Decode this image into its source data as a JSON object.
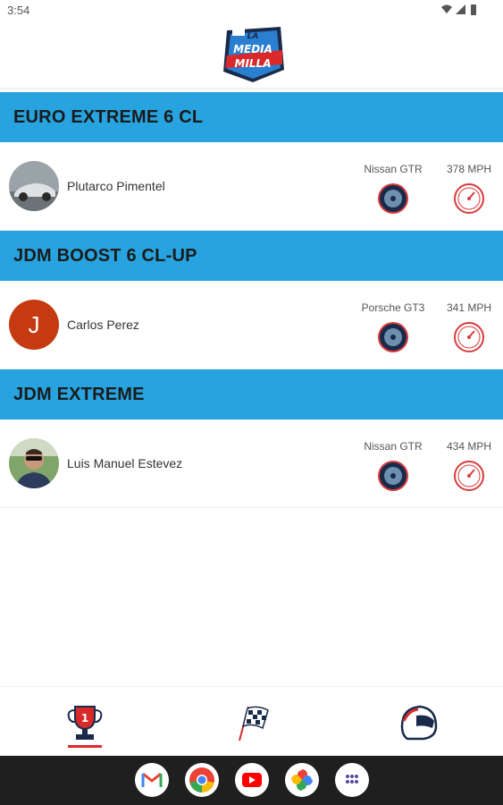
{
  "status_bar": {
    "time": "3:54"
  },
  "logo": {
    "text_top": "LA",
    "text_main": "MEDIA",
    "text_sub": "MILLA"
  },
  "sections": [
    {
      "title": "EURO EXTREME 6 CL",
      "entries": [
        {
          "driver": "Plutarco Pimentel",
          "car": "Nissan GTR",
          "speed": "378 MPH",
          "avatar": "car-photo"
        }
      ]
    },
    {
      "title": "JDM BOOST 6 CL-UP",
      "entries": [
        {
          "driver": "Carlos Perez",
          "car": "Porsche GT3",
          "speed": "341 MPH",
          "avatar_letter": "J",
          "avatar_color": "#c53a11"
        }
      ]
    },
    {
      "title": "JDM EXTREME",
      "entries": [
        {
          "driver": "Luis Manuel Estevez",
          "car": "Nissan GTR",
          "speed": "434 MPH",
          "avatar": "person-photo"
        }
      ]
    }
  ],
  "bottom_nav": [
    {
      "icon": "trophy-icon",
      "active": true
    },
    {
      "icon": "checkered-flag-icon",
      "active": false
    },
    {
      "icon": "helmet-icon",
      "active": false
    }
  ],
  "dock": [
    {
      "icon": "gmail-icon"
    },
    {
      "icon": "chrome-icon"
    },
    {
      "icon": "youtube-icon"
    },
    {
      "icon": "photos-icon"
    },
    {
      "icon": "app-drawer-icon"
    }
  ],
  "colors": {
    "section_header": "#27a4e0",
    "accent_red": "#e02b2b",
    "navy": "#1a2a4a"
  }
}
